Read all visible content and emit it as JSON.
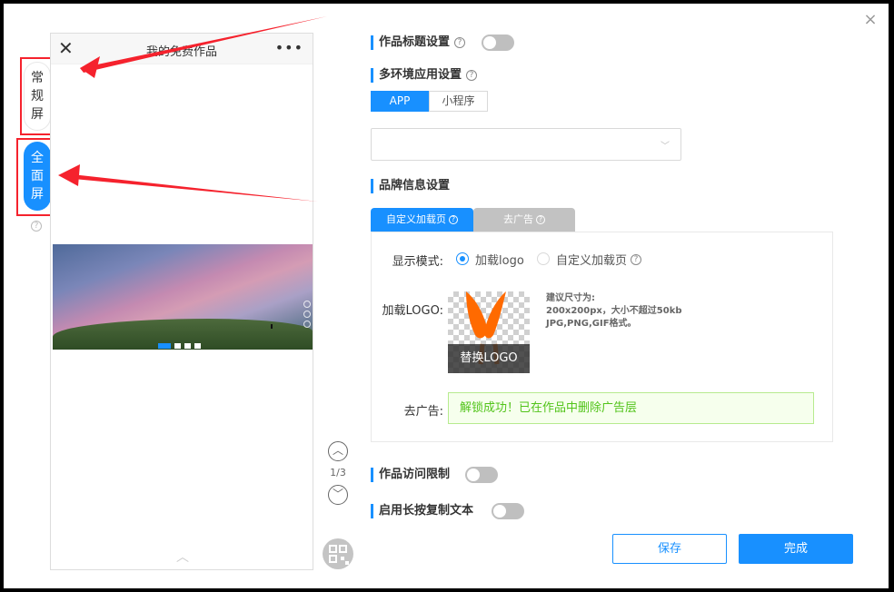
{
  "dialog": {
    "close_glyph": "×"
  },
  "mode_tabs": {
    "normal": [
      "常",
      "规",
      "屏"
    ],
    "full": [
      "全",
      "面",
      "屏"
    ],
    "help": "?"
  },
  "phone": {
    "title": "我的免费作品",
    "close_glyph": "✕",
    "more_glyph": "•••",
    "up_glyph": "︿"
  },
  "pager": {
    "up": "︿",
    "down": "﹀",
    "text": "1/3"
  },
  "sections": {
    "title_setting": "作品标题设置",
    "multi_env": "多环境应用设置",
    "brand": "品牌信息设置",
    "access_limit": "作品访问限制",
    "long_press_copy": "启用长按复制文本"
  },
  "env_tabs": [
    "APP",
    "小程序"
  ],
  "select": {
    "value": "",
    "caret": "﹀"
  },
  "brand_tabs": [
    "自定义加载页",
    "去广告"
  ],
  "brand_panel": {
    "display_mode_label": "显示模式:",
    "options": [
      "加载logo",
      "自定义加载页"
    ],
    "selected_option": 0,
    "load_logo_label": "加载LOGO:",
    "replace_logo": "替换LOGO",
    "hint_lines": [
      "建议尺寸为:",
      "200x200px，大小不超过50kb",
      "JPG,PNG,GIF格式。"
    ],
    "remove_ad_label": "去广告:",
    "success_message": "解锁成功！已在作品中删除广告层"
  },
  "buttons": {
    "save": "保存",
    "done": "完成"
  },
  "colors": {
    "accent": "#1890ff",
    "annotation": "#f5222d",
    "logo_orange": "#ff6a00",
    "success": "#52c41a"
  }
}
